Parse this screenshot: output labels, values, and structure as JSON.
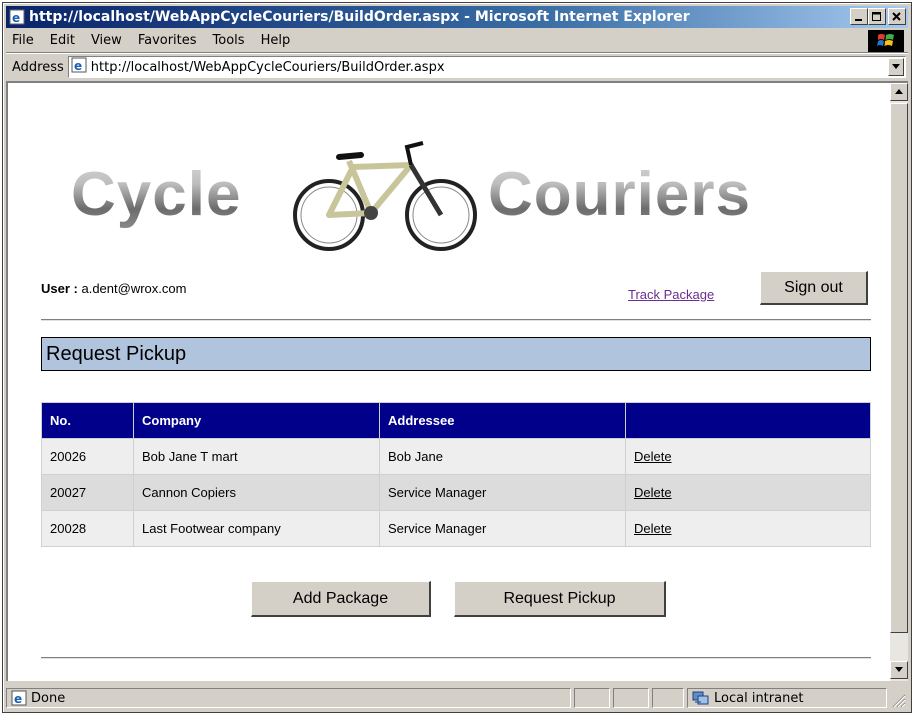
{
  "window": {
    "title": "http://localhost/WebAppCycleCouriers/BuildOrder.aspx - Microsoft Internet Explorer"
  },
  "menu": {
    "items": [
      {
        "label": "File"
      },
      {
        "label": "Edit"
      },
      {
        "label": "View"
      },
      {
        "label": "Favorites"
      },
      {
        "label": "Tools"
      },
      {
        "label": "Help"
      }
    ]
  },
  "address": {
    "label": "Address",
    "url": "http://localhost/WebAppCycleCouriers/BuildOrder.aspx"
  },
  "page": {
    "logo_left": "Cycle",
    "logo_right": "Couriers",
    "user_label": "User :",
    "user_email": "a.dent@wrox.com",
    "track_link": "Track Package",
    "signout_label": "Sign out",
    "section_title": "Request Pickup",
    "table": {
      "headers": [
        "No.",
        "Company",
        "Addressee",
        ""
      ],
      "rows": [
        {
          "no": "20026",
          "company": "Bob Jane T mart",
          "addressee": "Bob Jane",
          "action": "Delete"
        },
        {
          "no": "20027",
          "company": "Cannon Copiers",
          "addressee": "Service Manager",
          "action": "Delete"
        },
        {
          "no": "20028",
          "company": "Last Footwear company",
          "addressee": "Service Manager",
          "action": "Delete"
        }
      ]
    },
    "add_package_label": "Add Package",
    "request_pickup_label": "Request Pickup"
  },
  "status": {
    "text": "Done",
    "zone": "Local intranet"
  },
  "colors": {
    "section_bg": "#b0c4de",
    "table_header_bg": "#00008b",
    "link_visited": "#6b2e8e"
  }
}
